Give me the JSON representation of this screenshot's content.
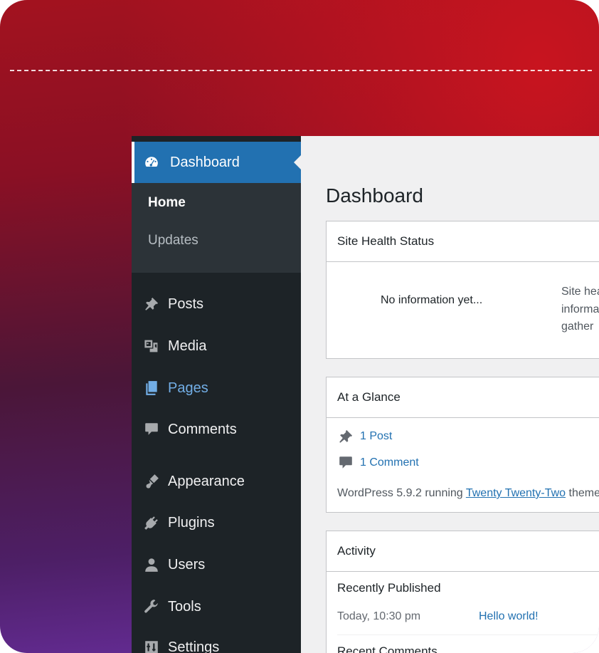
{
  "sidebar": {
    "active": {
      "label": "Dashboard",
      "icon": "dashboard-gauge-icon"
    },
    "submenu": [
      "Home",
      "Updates"
    ],
    "items": [
      {
        "label": "Posts",
        "icon": "pushpin-icon"
      },
      {
        "label": "Media",
        "icon": "media-icon"
      },
      {
        "label": "Pages",
        "icon": "pages-icon"
      },
      {
        "label": "Comments",
        "icon": "comment-bubble-icon"
      },
      {
        "label": "Appearance",
        "icon": "paintbrush-icon"
      },
      {
        "label": "Plugins",
        "icon": "plugin-icon"
      },
      {
        "label": "Users",
        "icon": "user-icon"
      },
      {
        "label": "Tools",
        "icon": "wrench-icon"
      },
      {
        "label": "Settings",
        "icon": "settings-sliders-icon"
      }
    ]
  },
  "main": {
    "title": "Dashboard",
    "site_health": {
      "title": "Site Health Status",
      "no_info": "No information yet...",
      "description": "Site hea\ninforma\ngather"
    },
    "at_a_glance": {
      "title": "At a Glance",
      "posts": "1 Post",
      "comments": "1 Comment",
      "wp_prefix": "WordPress 5.9.2 running ",
      "theme_link": "Twenty Twenty-Two",
      "wp_suffix": " theme"
    },
    "activity": {
      "title": "Activity",
      "recently_published": "Recently Published",
      "date": "Today, 10:30 pm",
      "post_link": "Hello world!",
      "recent_comments": "Recent Comments"
    }
  },
  "colors": {
    "sidebar_bg": "#1d2327",
    "active_bg": "#2271b1",
    "link": "#2271b1",
    "pages_highlight": "#72aee6"
  }
}
